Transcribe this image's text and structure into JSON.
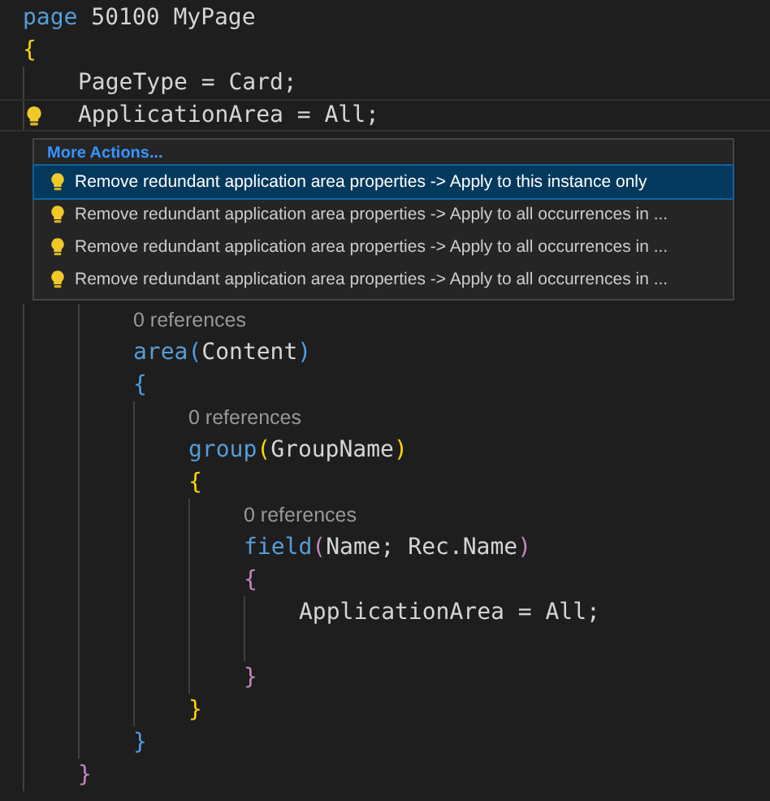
{
  "code_top": [
    {
      "kind": "code",
      "tokens": [
        {
          "kind": "keyword",
          "text": "page"
        },
        {
          "kind": "plain",
          "text": " 50100 MyPage"
        }
      ]
    },
    {
      "kind": "code",
      "tokens": [
        {
          "kind": "bracket1",
          "text": "{"
        }
      ]
    },
    {
      "kind": "block",
      "children": [
        {
          "kind": "code",
          "tokens": [
            {
              "kind": "plain",
              "text": "PageType = Card;"
            }
          ]
        },
        {
          "kind": "code",
          "current": true,
          "lightbulb": true,
          "tokens": [
            {
              "kind": "plain",
              "text": "ApplicationArea = All;"
            }
          ]
        }
      ]
    }
  ],
  "quick_fix_menu": {
    "header": "More Actions...",
    "items": [
      {
        "label": "Remove redundant application area properties -> Apply to this instance only",
        "selected": true
      },
      {
        "label": "Remove redundant application area properties -> Apply to all occurrences in ...",
        "selected": false
      },
      {
        "label": "Remove redundant application area properties -> Apply to all occurrences in ...",
        "selected": false
      },
      {
        "label": "Remove redundant application area properties -> Apply to all occurrences in ...",
        "selected": false
      }
    ]
  },
  "code_bottom": [
    {
      "kind": "block",
      "children": [
        {
          "kind": "lens",
          "text": "0 references"
        },
        {
          "kind": "code",
          "tokens": [
            {
              "kind": "keyword",
              "text": "area"
            },
            {
              "kind": "bracket2",
              "text": "("
            },
            {
              "kind": "plain",
              "text": "Content"
            },
            {
              "kind": "bracket2",
              "text": ")"
            }
          ]
        },
        {
          "kind": "code",
          "tokens": [
            {
              "kind": "bracket2",
              "text": "{"
            }
          ]
        },
        {
          "kind": "block",
          "children": [
            {
              "kind": "lens",
              "text": "0 references"
            },
            {
              "kind": "code",
              "tokens": [
                {
                  "kind": "keyword",
                  "text": "group"
                },
                {
                  "kind": "bracket1",
                  "text": "("
                },
                {
                  "kind": "plain",
                  "text": "GroupName"
                },
                {
                  "kind": "bracket1",
                  "text": ")"
                }
              ]
            },
            {
              "kind": "code",
              "tokens": [
                {
                  "kind": "bracket1",
                  "text": "{"
                }
              ]
            },
            {
              "kind": "block",
              "children": [
                {
                  "kind": "lens",
                  "text": "0 references"
                },
                {
                  "kind": "code",
                  "tokens": [
                    {
                      "kind": "keyword",
                      "text": "field"
                    },
                    {
                      "kind": "bracket3",
                      "text": "("
                    },
                    {
                      "kind": "plain",
                      "text": "Name; Rec.Name"
                    },
                    {
                      "kind": "bracket3",
                      "text": ")"
                    }
                  ]
                },
                {
                  "kind": "code",
                  "tokens": [
                    {
                      "kind": "bracket3",
                      "text": "{"
                    }
                  ]
                },
                {
                  "kind": "block",
                  "children": [
                    {
                      "kind": "code",
                      "tokens": [
                        {
                          "kind": "plain",
                          "text": "ApplicationArea = All;"
                        }
                      ]
                    },
                    {
                      "kind": "blank"
                    }
                  ]
                },
                {
                  "kind": "code",
                  "tokens": [
                    {
                      "kind": "bracket3",
                      "text": "}"
                    }
                  ]
                }
              ]
            },
            {
              "kind": "code",
              "tokens": [
                {
                  "kind": "bracket1",
                  "text": "}"
                }
              ]
            }
          ]
        },
        {
          "kind": "code",
          "tokens": [
            {
              "kind": "bracket2",
              "text": "}"
            }
          ]
        }
      ]
    },
    {
      "kind": "code",
      "tokens": [
        {
          "kind": "bracket3",
          "text": "}"
        }
      ]
    }
  ]
}
